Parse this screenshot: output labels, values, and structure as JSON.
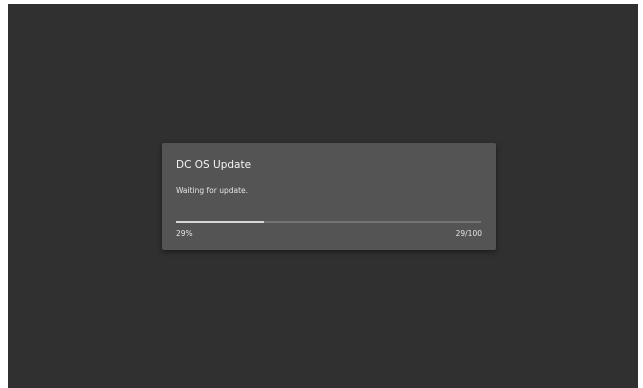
{
  "dialog": {
    "title": "DC OS Update",
    "message": "Waiting for update.",
    "progress": {
      "percent_label": "29%",
      "count_label": "29/100",
      "value": 29,
      "max": 100
    }
  },
  "colors": {
    "background": "#303030",
    "dialog": "#545454",
    "progress_track": "#737373",
    "progress_fill": "#d8d8d8"
  }
}
